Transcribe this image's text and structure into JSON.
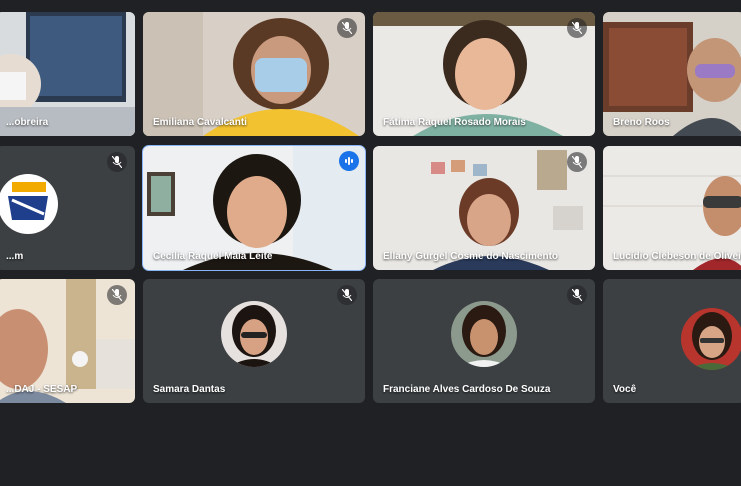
{
  "participants": [
    {
      "name": "...obreira",
      "muted": false
    },
    {
      "name": "Emiliana Cavalcanti",
      "muted": true
    },
    {
      "name": "Fátima Raquel Rosado Morais",
      "muted": true
    },
    {
      "name": "Breno Roos",
      "muted": false
    },
    {
      "name": "...m",
      "muted": true
    },
    {
      "name": "Cecília Raquel Maia Leite",
      "muted": false,
      "speaking": true
    },
    {
      "name": "Ellany Gurgel Cosme do Nascimento",
      "muted": true
    },
    {
      "name": "Lucídio Clebeson de Oliveira",
      "muted": false
    },
    {
      "name": "...DAJ - SESAP",
      "muted": true
    },
    {
      "name": "Samara Dantas",
      "muted": true
    },
    {
      "name": "Franciane Alves Cardoso De Souza",
      "muted": true
    },
    {
      "name": "Você",
      "muted": false
    }
  ],
  "colors": {
    "background": "#202124",
    "tile": "#3c4043",
    "speaking_outline": "#8ab4f8",
    "speaking_badge": "#1a73e8"
  },
  "icons": {
    "muted": "mic-off-icon",
    "speaking": "audio-level-icon"
  }
}
